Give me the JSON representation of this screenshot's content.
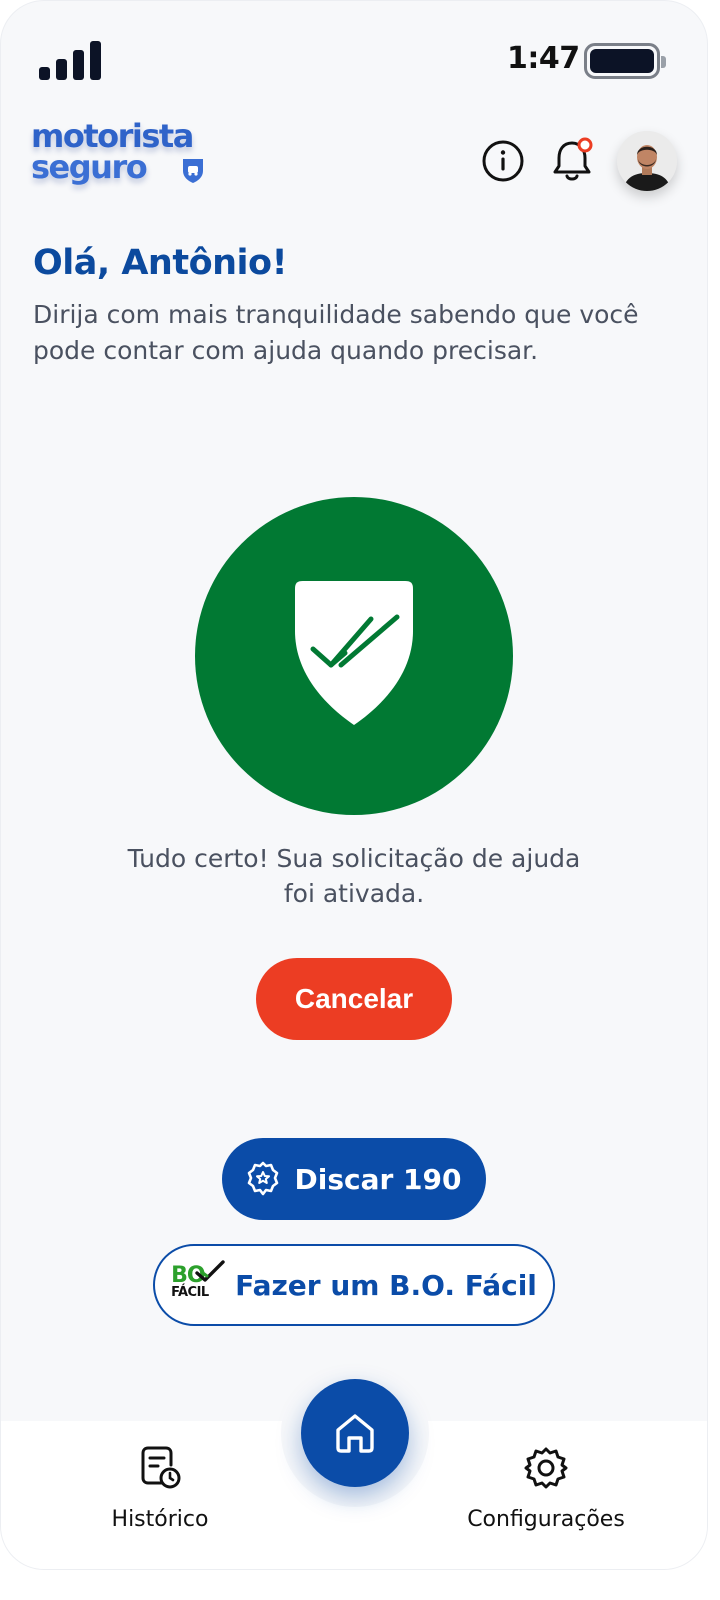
{
  "status_bar": {
    "time": "1:47"
  },
  "header": {
    "logo_line1": "motorista",
    "logo_line2": "seguro",
    "info_icon": "info-icon",
    "notification_icon": "bell-icon",
    "has_unread_notification": true,
    "avatar_icon": "user-avatar"
  },
  "greeting": {
    "title": "Olá, Antônio!",
    "subtitle": "Dirija com mais tranquilidade sabendo que você pode contar com ajuda quando precisar."
  },
  "status": {
    "icon": "shield-check-icon",
    "message": "Tudo certo! Sua solicitação de ajuda foi ativada.",
    "color": "#017933"
  },
  "actions": {
    "cancel_label": "Cancelar",
    "dial_label": "Discar 190",
    "bo_label": "Fazer um B.O. Fácil",
    "bo_logo_top": "BO",
    "bo_logo_bottom": "FÁCIL"
  },
  "bottom_nav": {
    "history_label": "Histórico",
    "home_icon": "home-icon",
    "settings_label": "Configurações"
  },
  "colors": {
    "primary": "#0b4ca8",
    "danger": "#ec3d23",
    "success": "#017933",
    "notification_dot": "#ec3d23"
  }
}
